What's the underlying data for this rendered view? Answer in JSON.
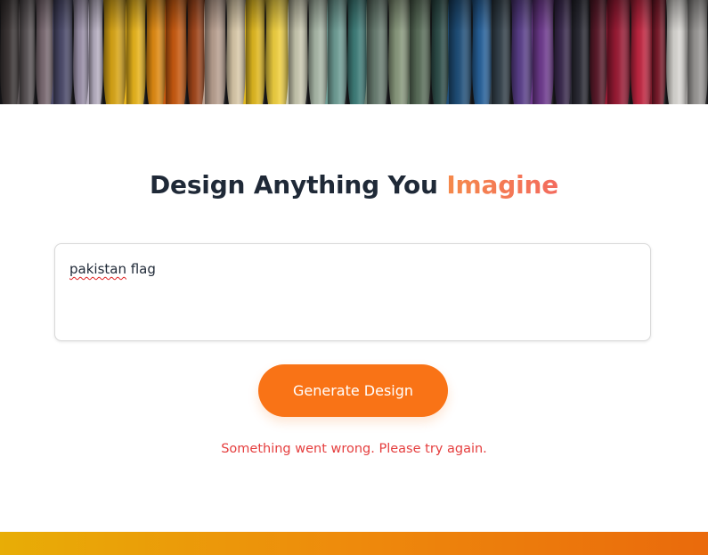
{
  "hero": {
    "image_name": "fabric-drapes-banner"
  },
  "headline": {
    "text_main": "Design Anything You ",
    "text_accent": "Imagine"
  },
  "prompt": {
    "value_misspelled": "pakistan",
    "value_rest": " flag"
  },
  "actions": {
    "generate_label": "Generate Design"
  },
  "status": {
    "error_message": "Something went wrong. Please try again."
  },
  "colors": {
    "accent": "#f97316",
    "heading": "#1f2937",
    "error": "#e53e3e",
    "footer_start": "#e8ad06",
    "footer_end": "#ea6a0c"
  }
}
